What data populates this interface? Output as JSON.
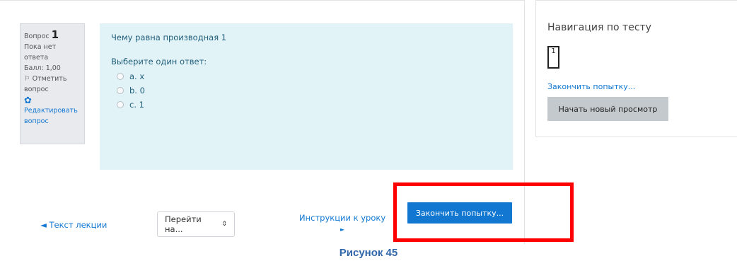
{
  "question_info": {
    "label": "Вопрос",
    "number": "1",
    "status": "Пока нет ответа",
    "score": "Балл: 1,00",
    "flag": "Отметить вопрос",
    "edit": "Редактировать вопрос"
  },
  "question": {
    "text": "Чему равна производная 1",
    "prompt": "Выберите один ответ:",
    "options": [
      "a. x",
      "b. 0",
      "c. 1"
    ]
  },
  "bottom_nav": {
    "prev_link": "◄ Текст лекции",
    "jump_select": "Перейти на...",
    "next_link": "Инструкции к уроку",
    "next_arrow": "►"
  },
  "finish_button": "Закончить попытку...",
  "navigation": {
    "title": "Навигация по тесту",
    "question_number": "1",
    "finish_link": "Закончить попытку...",
    "new_preview_button": "Начать новый просмотр"
  },
  "caption": "Рисунок 45",
  "colors": {
    "accent": "#1177d1",
    "highlight_box": "#ff0000",
    "question_bg": "#e2f3f8",
    "info_bg": "#e8eaee"
  }
}
